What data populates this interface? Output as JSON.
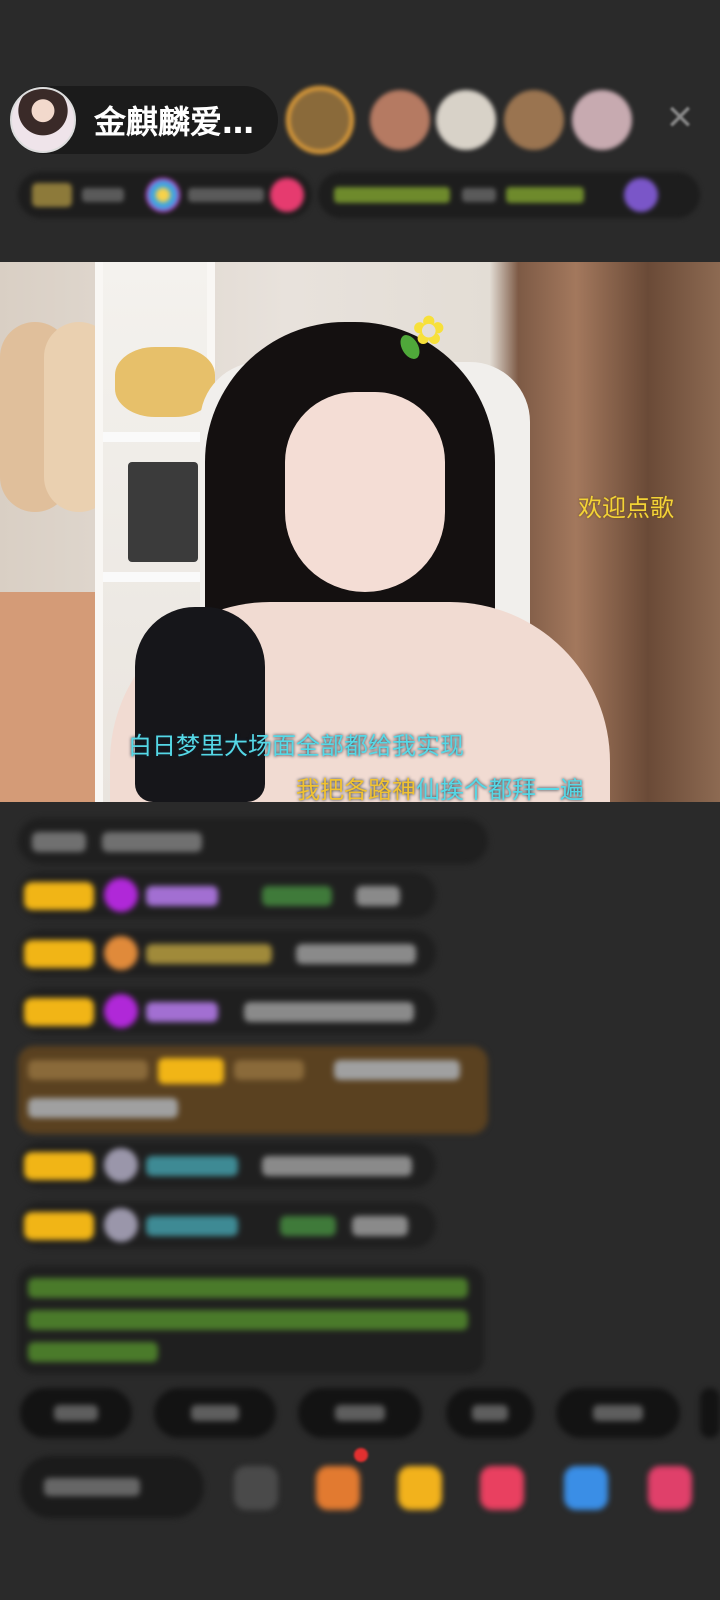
{
  "header": {
    "host_name": "金麒麟爱…",
    "viewers": [
      {
        "color": "#8a6a3a"
      },
      {
        "color": "#b57a62"
      },
      {
        "color": "#d8d2c8"
      },
      {
        "color": "#9a7450"
      },
      {
        "color": "#c7aab0"
      }
    ],
    "close_icon": "close-icon"
  },
  "video": {
    "overlay_text": "欢迎点歌",
    "lyric_line_1": "白日梦里大场面全部都给我实现",
    "lyric_line_2_sung": "我把各路神",
    "lyric_line_2_rest": "仙挨个都拜一遍"
  },
  "colors": {
    "lyric": "#55d8e6",
    "lyric_sung": "#f1c232",
    "overlay": "#f3d336",
    "badge": "#f1b516",
    "background": "#2a2a2a"
  }
}
